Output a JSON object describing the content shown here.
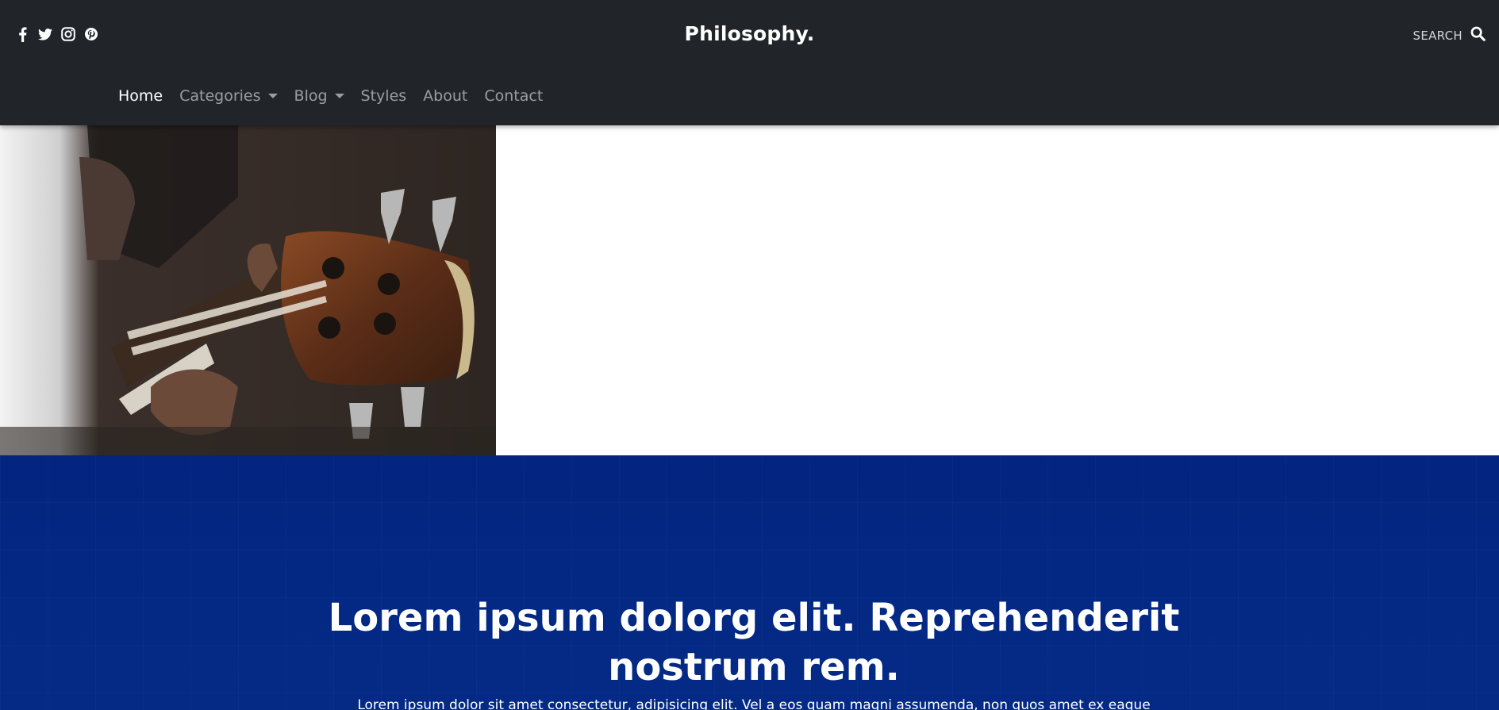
{
  "header": {
    "brand": "Philosophy.",
    "search_label": "SEARCH",
    "social_icons": [
      "facebook-icon",
      "twitter-icon",
      "instagram-icon",
      "pinterest-icon"
    ],
    "background_color": "#212529"
  },
  "nav": {
    "items": [
      {
        "label": "Home",
        "active": true
      },
      {
        "label": "Categories",
        "dropdown": true
      },
      {
        "label": "Blog",
        "dropdown": true
      },
      {
        "label": "Styles"
      },
      {
        "label": "About"
      },
      {
        "label": "Contact"
      }
    ]
  },
  "hero": {
    "image": "guitar-headstock-photo"
  },
  "banner": {
    "background_color": "#03247f",
    "headline": "Lorem ipsum dolorg elit. Reprehenderit nostrum rem.",
    "subtext": "Lorem ipsum dolor sit amet consectetur, adipisicing elit. Vel a eos quam magni assumenda, non quos amet ex eaque"
  }
}
